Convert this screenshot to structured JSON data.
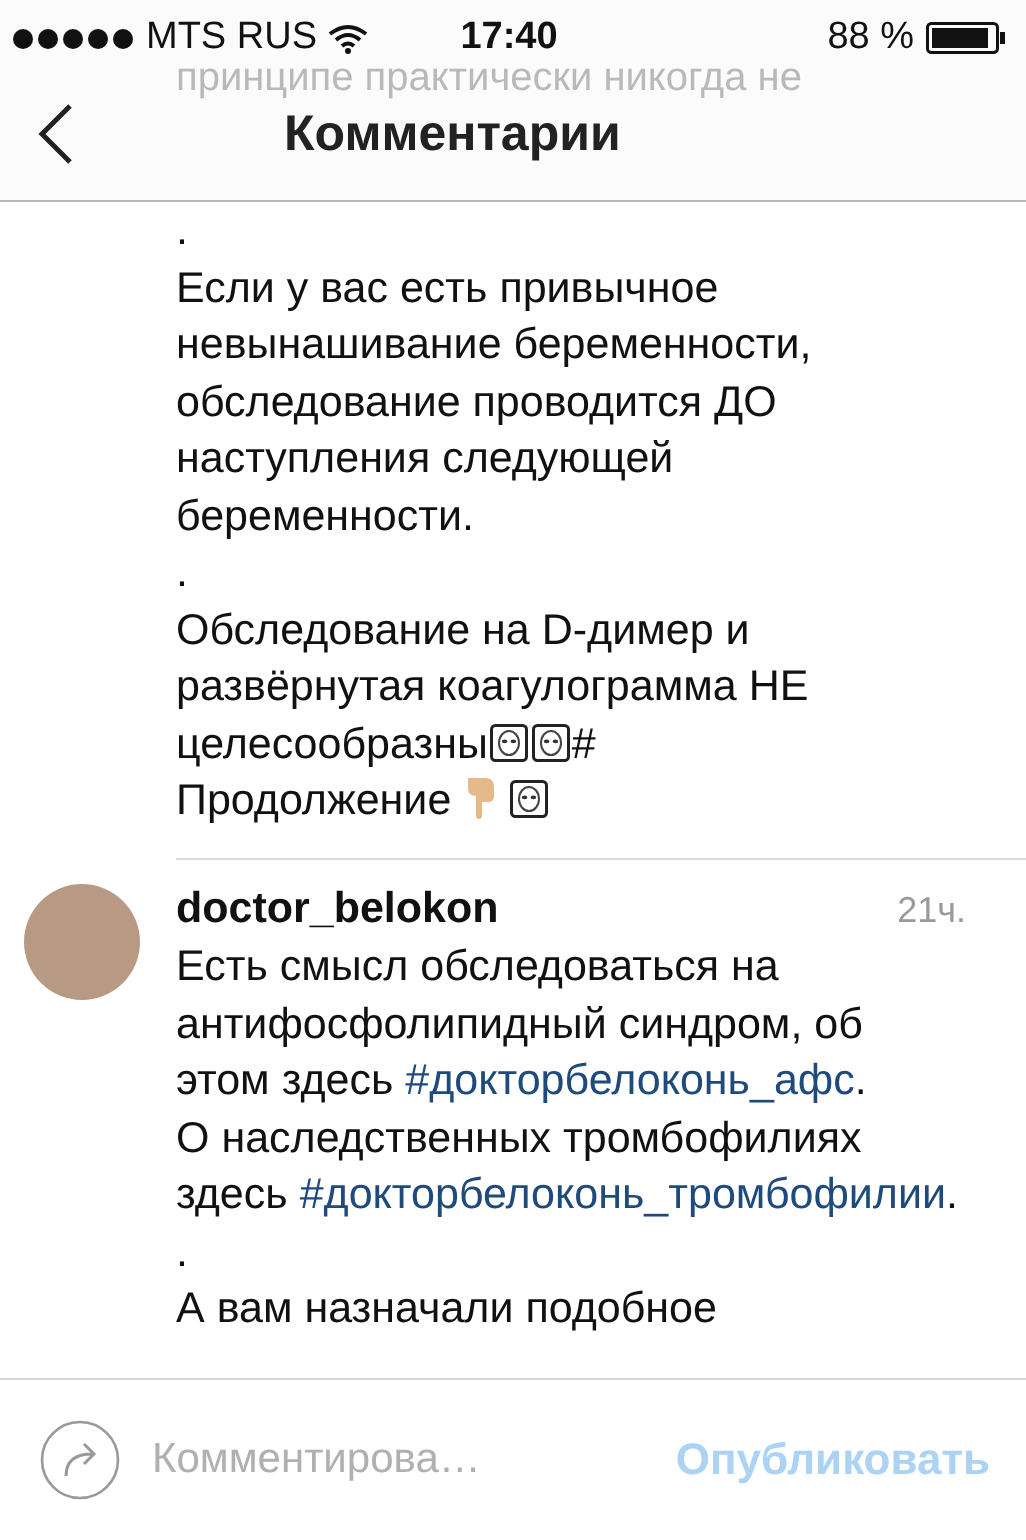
{
  "status_bar": {
    "carrier": "MTS RUS",
    "time": "17:40",
    "battery": "88 %"
  },
  "header": {
    "title": "Комментарии"
  },
  "scrolled_text": [
    "принципе практически никогда не"
  ],
  "comments": [
    {
      "paragraphs": [
        [
          {
            "kind": "text",
            "text": "."
          }
        ],
        [
          {
            "kind": "text",
            "text": "Если у вас есть привычное невынашивание беременности, обследование проводится ДО наступления следующей беременности."
          }
        ],
        [
          {
            "kind": "text",
            "text": "."
          }
        ],
        [
          {
            "kind": "text",
            "text": "Обследование на D-димер и развёрнутая коагулограмма НЕ целесообразны"
          },
          {
            "kind": "alien"
          },
          {
            "kind": "alien"
          },
          {
            "kind": "text",
            "text": "#"
          }
        ],
        [
          {
            "kind": "text",
            "text": "Продолжение"
          },
          {
            "kind": "hand"
          },
          {
            "kind": "alien"
          }
        ]
      ]
    },
    {
      "username": "doctor_belokon",
      "time": "21ч.",
      "paragraphs": [
        [
          {
            "kind": "text",
            "text": "Есть смысл обследоваться на антифосфолипидный синдром, об этом здесь "
          },
          {
            "kind": "tag",
            "text": "#докторбелоконь_афс"
          },
          {
            "kind": "text",
            "text": "."
          }
        ],
        [
          {
            "kind": "text",
            "text": "О наследственных тромбофилиях здесь "
          },
          {
            "kind": "tag",
            "text": "#докторбелоконь_тромбофилии"
          },
          {
            "kind": "text",
            "text": "."
          }
        ],
        [
          {
            "kind": "text",
            "text": "."
          }
        ],
        [
          {
            "kind": "text",
            "text": "А вам назначали подобное"
          }
        ]
      ]
    }
  ],
  "composer": {
    "placeholder": "Комментирова…",
    "post": "Опубликовать",
    "disabled": true
  }
}
